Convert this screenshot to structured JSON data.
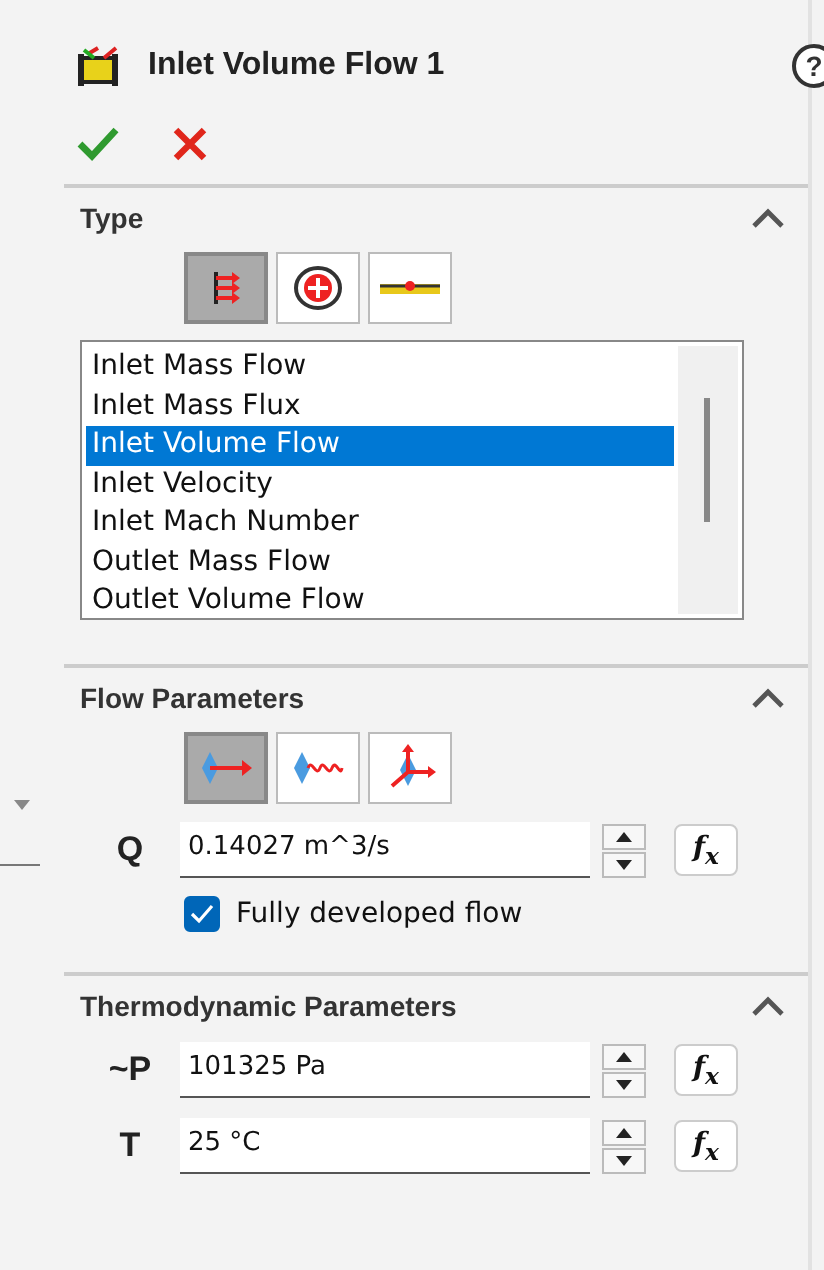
{
  "header": {
    "title": "Inlet Volume Flow 1",
    "help": "?"
  },
  "sections": [
    {
      "kind": "type",
      "title": "Type",
      "expanded": true,
      "modes": [
        {
          "selected": true
        },
        {
          "selected": false
        },
        {
          "selected": false
        }
      ],
      "items": [
        {
          "label": "Inlet Mass Flow",
          "selected": false
        },
        {
          "label": "Inlet Mass Flux",
          "selected": false
        },
        {
          "label": "Inlet Volume Flow",
          "selected": true
        },
        {
          "label": "Inlet Velocity",
          "selected": false
        },
        {
          "label": "Inlet Mach Number",
          "selected": false
        },
        {
          "label": "Outlet Mass Flow",
          "selected": false
        },
        {
          "label": "Outlet Volume Flow",
          "selected": false
        }
      ]
    },
    {
      "kind": "params",
      "title": "Flow Parameters",
      "expanded": true,
      "modes": [
        {
          "selected": true
        },
        {
          "selected": false
        },
        {
          "selected": false
        }
      ],
      "fields": [
        {
          "label": "Q",
          "value": "0.14027 m^3/s",
          "fx": "f$_{x}$"
        }
      ],
      "checkbox": {
        "label": "Fully developed flow",
        "checked": true
      }
    },
    {
      "kind": "params",
      "title": "Thermodynamic Parameters",
      "expanded": true,
      "fields": [
        {
          "label": "~P",
          "value": "101325 Pa",
          "fx": "f$_{x}$"
        },
        {
          "label": "T",
          "value": "25 °C",
          "fx": "f$_{x}$"
        }
      ]
    }
  ]
}
